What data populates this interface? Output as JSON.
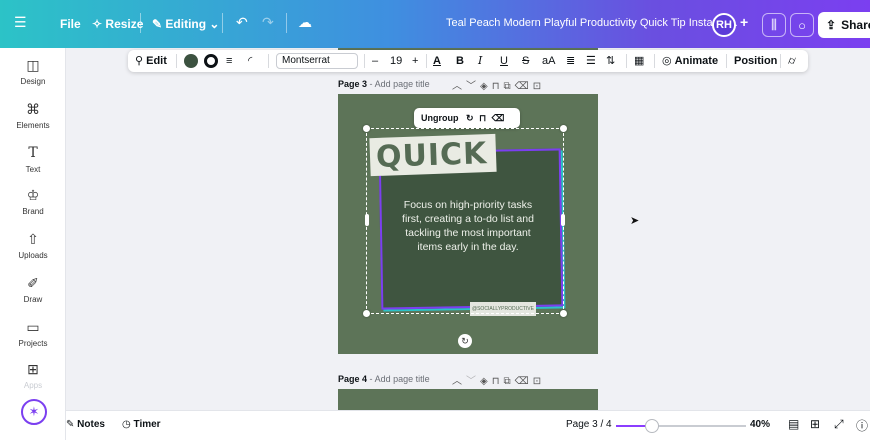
{
  "topbar": {
    "menu_icon": "hamburger-icon",
    "file": "File",
    "resize": "Resize",
    "editing": "Editing",
    "doc_title": "Teal Peach Modern Playful Productivity Quick Tip Instagra...",
    "avatar_initials": "RH",
    "share": "Share"
  },
  "sidebar": {
    "items": [
      {
        "label": "Design",
        "icon": "design-icon"
      },
      {
        "label": "Elements",
        "icon": "elements-icon"
      },
      {
        "label": "Text",
        "icon": "text-icon"
      },
      {
        "label": "Brand",
        "icon": "brand-icon"
      },
      {
        "label": "Uploads",
        "icon": "uploads-icon"
      },
      {
        "label": "Draw",
        "icon": "draw-icon"
      },
      {
        "label": "Projects",
        "icon": "projects-icon"
      },
      {
        "label": "Apps",
        "icon": "apps-icon"
      }
    ]
  },
  "toolbar": {
    "edit": "Edit",
    "font": "Montserrat",
    "font_size": "19",
    "animate": "Animate",
    "position": "Position"
  },
  "page3": {
    "label": "Page 3",
    "title_placeholder": "Add page title"
  },
  "page4": {
    "label": "Page 4",
    "title_placeholder": "Add page title"
  },
  "design": {
    "heading": "QUICK TIP",
    "body": "Focus on high-priority tasks first, creating a to-do list and tackling the most important items early in the day.",
    "handle": "@SOCIALLYPRODUCTIVE",
    "ungroup": "Ungroup"
  },
  "bottombar": {
    "notes": "Notes",
    "timer": "Timer",
    "page_indicator": "Page 3 / 4",
    "zoom": "40%",
    "zoom_fraction": 0.28
  },
  "colors": {
    "card_bg": "#5d7458",
    "panel_bg": "#3f5540",
    "accent_purple": "#7b3ff0",
    "accent_teal": "#2cc3c7"
  }
}
